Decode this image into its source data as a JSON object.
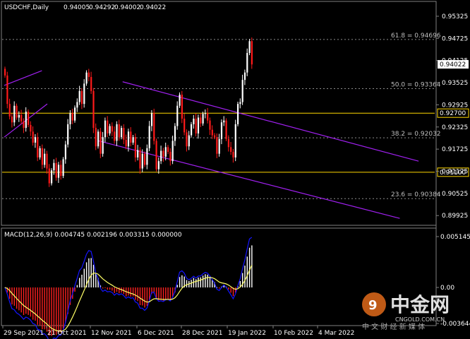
{
  "header": {
    "symbol": "USDCHF,Daily",
    "open": "0.94005",
    "high": "0.94292",
    "low": "0.94002",
    "close": "0.94022"
  },
  "price_axis": {
    "ticks": [
      "0.95325",
      "0.94725",
      "0.94125",
      "0.93525",
      "0.92925",
      "0.92325",
      "0.91725",
      "0.91125",
      "0.90525",
      "0.89925"
    ],
    "current_price": "0.94022"
  },
  "horizontal_levels": [
    {
      "value": 0.927,
      "label": "0.92700",
      "color": "#ffd700"
    },
    {
      "value": 0.911,
      "label": "0.91100",
      "color": "#ffd700"
    }
  ],
  "fibonacci_levels": [
    {
      "value": 0.94696,
      "label": "61.8 = 0.94696"
    },
    {
      "value": 0.93364,
      "label": "50.0 = 0.93364"
    },
    {
      "value": 0.92032,
      "label": "38.2 = 0.92032"
    },
    {
      "value": 0.90384,
      "label": "23.6 = 0.90384"
    }
  ],
  "macd_panel": {
    "label": "MACD(12,26,9) 0.004745 0.002196 0.003315 0.000000",
    "ticks": [
      "0.005145",
      "0.00",
      "-0.003644"
    ]
  },
  "date_axis": {
    "labels": [
      "29 Sep 2021",
      "21 Oct 2021",
      "12 Nov 2021",
      "6 Dec 2021",
      "28 Dec 2021",
      "19 Jan 2022",
      "10 Feb 2022",
      "4 Mar 2022"
    ]
  },
  "watermark": {
    "main": "中金网",
    "sub": "中 文 财 经 新 媒 体",
    "url": "CNGOLD.COM.CN"
  },
  "colors": {
    "background": "#000000",
    "bull_candle": "#ffffff",
    "bear_candle": "#ff1a1a",
    "channel": "#a020f0",
    "level": "#ffd700",
    "macd_line": "#1515ff",
    "signal_line": "#ffff66"
  },
  "chart_data": {
    "type": "candlestick",
    "symbol": "USDCHF",
    "timeframe": "Daily",
    "y_range": [
      0.897,
      0.9565
    ],
    "candles_approx_close": [
      0.9372,
      0.9295,
      0.9261,
      0.9245,
      0.929,
      0.9258,
      0.9265,
      0.9248,
      0.923,
      0.9274,
      0.9238,
      0.922,
      0.919,
      0.9205,
      0.915,
      0.9175,
      0.913,
      0.916,
      0.912,
      0.908,
      0.9115,
      0.9135,
      0.9095,
      0.913,
      0.91,
      0.9145,
      0.9185,
      0.924,
      0.927,
      0.925,
      0.9285,
      0.93,
      0.933,
      0.9295,
      0.935,
      0.938,
      0.9368,
      0.933,
      0.923,
      0.918,
      0.922,
      0.916,
      0.9205,
      0.925,
      0.9215,
      0.9235,
      0.922,
      0.9195,
      0.924,
      0.9205,
      0.923,
      0.9198,
      0.918,
      0.922,
      0.919,
      0.9205,
      0.915,
      0.917,
      0.912,
      0.916,
      0.913,
      0.9175,
      0.9235,
      0.927,
      0.9195,
      0.9118,
      0.914,
      0.9168,
      0.9152,
      0.9178,
      0.9165,
      0.914,
      0.9195,
      0.9235,
      0.929,
      0.932,
      0.9255,
      0.9218,
      0.918,
      0.921,
      0.924,
      0.9255,
      0.9215,
      0.9258,
      0.9242,
      0.9268,
      0.927,
      0.925,
      0.9225,
      0.921,
      0.9205,
      0.916,
      0.92,
      0.9245,
      0.925,
      0.92,
      0.9178,
      0.9165,
      0.915,
      0.924,
      0.9295,
      0.93,
      0.936,
      0.938,
      0.9433,
      0.9465,
      0.9402
    ],
    "channels": [
      {
        "name": "upper",
        "from": [
          "2021-09-27",
          0.9345
        ],
        "to": [
          "2021-10-11",
          0.9385
        ]
      },
      {
        "name": "upper-left lower",
        "from": [
          "2021-09-27",
          0.9205
        ],
        "to": [
          "2021-10-13",
          0.9295
        ]
      },
      {
        "name": "descending top",
        "from": [
          "2021-11-10",
          0.9355
        ],
        "to": [
          "2022-02-28",
          0.914
        ]
      },
      {
        "name": "descending bottom",
        "from": [
          "2021-11-01",
          0.9195
        ],
        "to": [
          "2022-02-21",
          0.8985
        ]
      }
    ],
    "macd": {
      "params": [
        12,
        26,
        9
      ],
      "values": [
        0.004745,
        0.002196,
        0.003315,
        0.0
      ],
      "y_range": [
        -0.003644,
        0.005145
      ]
    }
  }
}
